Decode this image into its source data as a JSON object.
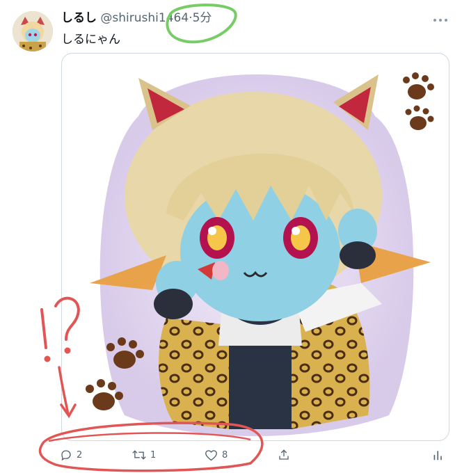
{
  "tweet": {
    "display_name": "しるし",
    "handle": "@shirushi1464",
    "separator": "·",
    "time": "5分",
    "text": "しるにゃん"
  },
  "actions": {
    "replies": "2",
    "retweets": "1",
    "likes": "8"
  },
  "annotations": {
    "marks": "!?",
    "circle_color_green": "#77cc66",
    "marker_color_red": "#e25555"
  },
  "icons": [
    "more-dots-icon",
    "reply-icon",
    "retweet-icon",
    "like-icon",
    "share-icon",
    "analytics-icon"
  ]
}
